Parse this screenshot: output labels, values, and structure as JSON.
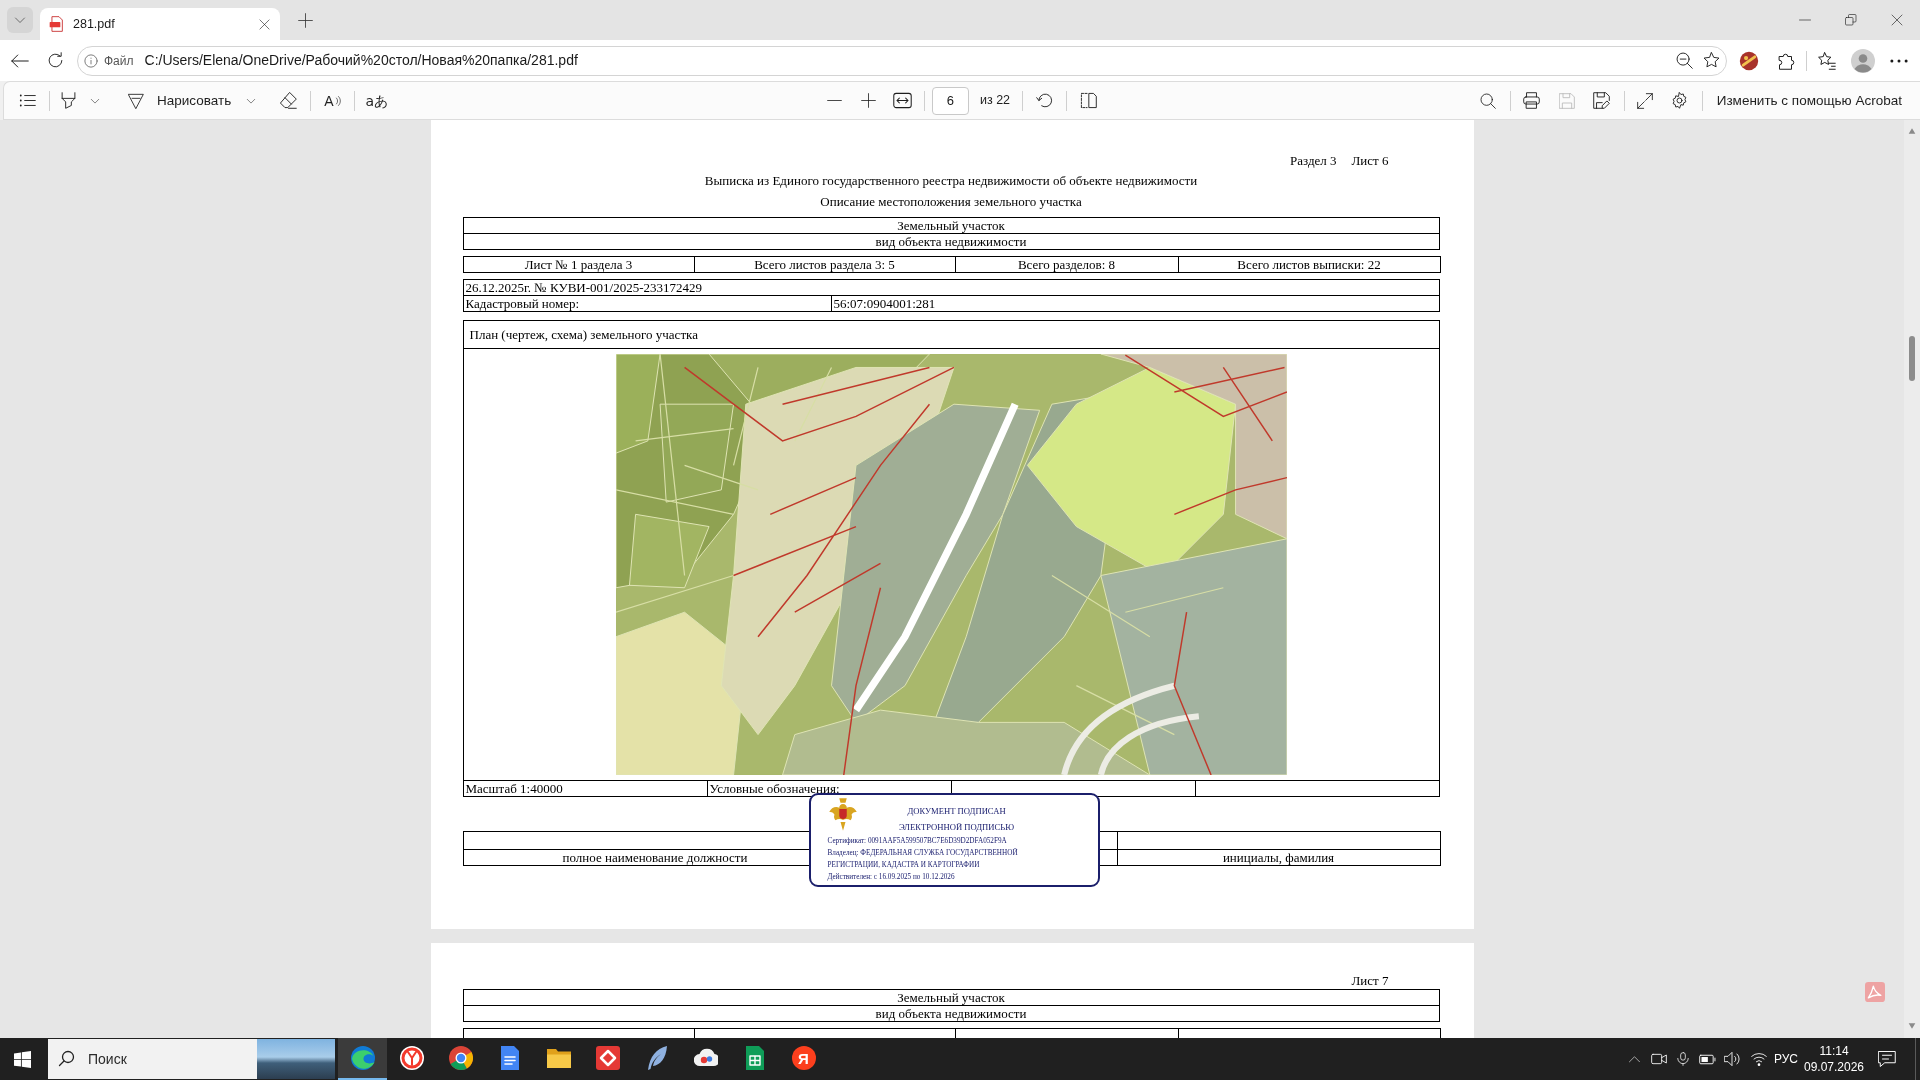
{
  "browser": {
    "tabs": [
      {
        "title": "281.pdf",
        "selected": true
      }
    ],
    "address": {
      "scheme": "Файл",
      "url": "C:/Users/Elena/OneDrive/Рабочий%20стол/Новая%20папка/281.pdf"
    }
  },
  "pdf_toolbar": {
    "draw_label": "Нарисовать",
    "read_aloud_glyph": "A",
    "translate_glyph": "aあ",
    "page": "6",
    "page_count": "из 22",
    "save_disabled": true,
    "acrobat_label": "Изменить с помощью Acrobat"
  },
  "pages": [
    {
      "section": "Раздел 3",
      "sheet": "Лист 6",
      "title": "Выписка из Единого государственного реестра недвижимости об объекте недвижимости",
      "subtitle": "Описание местоположения земельного участка",
      "object_type": "Земельный участок",
      "object_type_caption": "вид объекта недвижимости",
      "sheet_info": [
        "Лист № 1 раздела 3",
        "Всего листов раздела 3: 5",
        "Всего разделов: 8",
        "Всего листов выписки: 22"
      ],
      "record": "26.12.2025г. № КУВИ-001/2025-233172429",
      "cadastral_label": "Кадастровый номер:",
      "cadastral_number": "56:07:0904001:281",
      "plan": {
        "title": "План (чертеж, схема) земельного участка",
        "scale": "Масштаб 1:40000",
        "legend_label": "Условные обозначения:"
      },
      "signature": {
        "position_caption": "полное наименование должности",
        "name_caption": "инициалы, фамилия"
      },
      "stamp": {
        "heading": "ДОКУМЕНТ ПОДПИСАН ЭЛЕКТРОННОЙ ПОДПИСЬЮ",
        "certificate": "Сертификат: 0091AAF5A599507BC7E6D39D2DFA052F9A",
        "owner": "Владелец: ФЕДЕРАЛЬНАЯ СЛУЖБА ГОСУДАРСТВЕННОЙ РЕГИСТРАЦИИ, КАДАСТРА И КАРТОГРАФИИ",
        "validity": "Действителен: с 16.09.2025 по 10.12.2026"
      }
    },
    {
      "sheet": "Лист 7",
      "object_type": "Земельный участок",
      "object_type_caption": "вид объекта недвижимости"
    }
  ],
  "taskbar": {
    "search_placeholder": "Поиск",
    "apps": [
      {
        "kind": "swirl",
        "selected": true
      },
      {
        "kind": "ring",
        "selected": false
      },
      {
        "kind": "tricolor",
        "selected": false
      },
      {
        "kind": "document",
        "selected": false
      },
      {
        "kind": "folder",
        "selected": false
      },
      {
        "kind": "diamond",
        "selected": false
      },
      {
        "kind": "feather",
        "selected": false
      },
      {
        "kind": "cloud",
        "selected": false
      },
      {
        "kind": "sheet",
        "selected": false
      },
      {
        "kind": "letter",
        "glyph": "Я",
        "selected": false
      }
    ],
    "language": "РУС",
    "time": "11:14",
    "date": "09.07.2026"
  }
}
